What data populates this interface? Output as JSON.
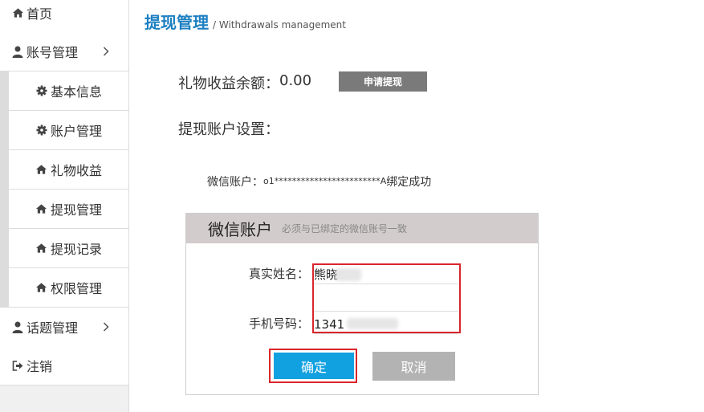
{
  "sidebar": {
    "items": [
      {
        "label": "首页",
        "icon": "home-icon"
      },
      {
        "label": "账号管理",
        "icon": "user-icon",
        "chevron": "chevron-right-icon"
      },
      {
        "label": "基本信息",
        "icon": "gear-icon"
      },
      {
        "label": "账户管理",
        "icon": "gear-icon"
      },
      {
        "label": "礼物收益",
        "icon": "home-icon"
      },
      {
        "label": "提现管理",
        "icon": "home-icon"
      },
      {
        "label": "提现记录",
        "icon": "home-icon"
      },
      {
        "label": "权限管理",
        "icon": "home-icon"
      },
      {
        "label": "话题管理",
        "icon": "user-icon",
        "chevron": "chevron-right-icon"
      },
      {
        "label": "注销",
        "icon": "logout-icon"
      }
    ]
  },
  "header": {
    "title": "提现管理",
    "subtitle": "/ Withdrawals management"
  },
  "balance": {
    "label": "礼物收益余额：",
    "value": "0.00",
    "apply_button": "申请提现"
  },
  "account_settings_label": "提现账户设置：",
  "wechat": {
    "prefix": "微信账户：",
    "account": "o1************************A",
    "status": "绑定成功"
  },
  "panel": {
    "title": "微信账户",
    "hint": "必须与已绑定的微信账号一致",
    "name_label": "真实姓名：",
    "name_value": "熊晓",
    "phone_label": "手机号码：",
    "phone_value": "1341",
    "confirm": "确定",
    "cancel": "取消"
  },
  "colors": {
    "accent": "#1c7fc1",
    "confirm_bg": "#12a1e0",
    "highlight": "#d9262b",
    "panel_header": "#d3cccc"
  }
}
